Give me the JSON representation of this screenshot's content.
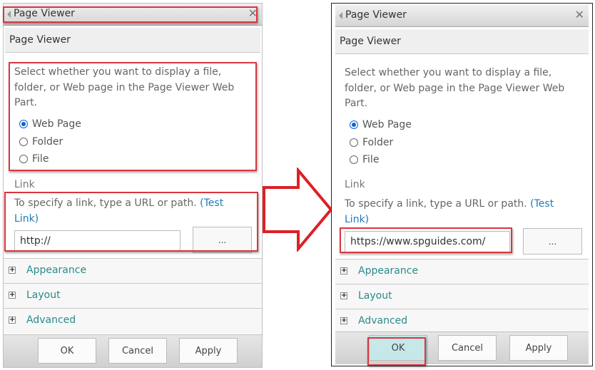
{
  "colors": {
    "highlight": "#d9363e",
    "link": "#1f7ab8",
    "section_link": "#2b8a8a",
    "radio_checked": "#0a62d6",
    "ok_active_bg": "#c6e8e8"
  },
  "before": {
    "titlebar": {
      "title": "Page Viewer",
      "collapse_icon": "triangle-left-icon",
      "close_icon": "close-icon",
      "close_glyph": "✕"
    },
    "subheader": "Page Viewer",
    "description": "Select whether you want to display a file, folder, or Web page in the Page Viewer Web Part.",
    "radios": [
      {
        "label": "Web Page",
        "checked": true
      },
      {
        "label": "Folder",
        "checked": false
      },
      {
        "label": "File",
        "checked": false
      }
    ],
    "link_section": {
      "label": "Link",
      "description": "To specify a link, type a URL or path.",
      "test_link": "(Test Link)",
      "url_value": "http://",
      "browse_label": "..."
    },
    "collapsibles": [
      {
        "label": "Appearance",
        "icon": "plus-icon",
        "glyph": "+"
      },
      {
        "label": "Layout",
        "icon": "plus-icon",
        "glyph": "+"
      },
      {
        "label": "Advanced",
        "icon": "plus-icon",
        "glyph": "+"
      }
    ],
    "footer": {
      "ok": "OK",
      "cancel": "Cancel",
      "apply": "Apply"
    }
  },
  "after": {
    "titlebar": {
      "title": "Page Viewer",
      "collapse_icon": "triangle-left-icon",
      "close_icon": "close-icon",
      "close_glyph": "✕"
    },
    "subheader": "Page Viewer",
    "description": "Select whether you want to display a file, folder, or Web page in the Page Viewer Web Part.",
    "radios": [
      {
        "label": "Web Page",
        "checked": true
      },
      {
        "label": "Folder",
        "checked": false
      },
      {
        "label": "File",
        "checked": false
      }
    ],
    "link_section": {
      "label": "Link",
      "description": "To specify a link, type a URL or path.",
      "test_link": "(Test Link)",
      "url_value": "https://www.spguides.com/",
      "browse_label": "..."
    },
    "collapsibles": [
      {
        "label": "Appearance",
        "icon": "plus-icon",
        "glyph": "+"
      },
      {
        "label": "Layout",
        "icon": "plus-icon",
        "glyph": "+"
      },
      {
        "label": "Advanced",
        "icon": "plus-icon",
        "glyph": "+"
      }
    ],
    "footer": {
      "ok": "OK",
      "cancel": "Cancel",
      "apply": "Apply",
      "ok_active": true
    }
  },
  "arrow": {
    "icon": "right-arrow-icon",
    "meaning": "before-to-after"
  }
}
